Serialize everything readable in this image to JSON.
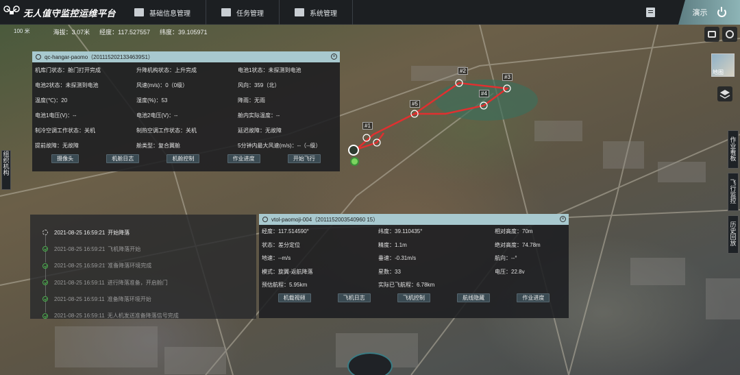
{
  "app": {
    "title": "无人值守监控运维平台"
  },
  "nav": [
    {
      "label": "基础信息管理",
      "icon": "database-icon"
    },
    {
      "label": "任务管理",
      "icon": "task-icon"
    },
    {
      "label": "系统管理",
      "icon": "settings-icon"
    }
  ],
  "header": {
    "demo_label": "演示"
  },
  "status": {
    "scale": "100 米",
    "altitude": "海拔：3.07米",
    "longitude": "经度：117.527557",
    "latitude": "纬度：39.105971"
  },
  "right_tools": {
    "basemap_label": "地图"
  },
  "side_tabs": {
    "work_board": "作业看板",
    "flight_monitor": "飞行监控",
    "history_replay": "历史回放",
    "org": "组织机构"
  },
  "hangar": {
    "title": "qc-hangar-paomo（2011152021334639S1）",
    "fields": [
      "机库门状态：舱门打开完成",
      "升降机构状态：上升完成",
      "电池1状态：未探测到电池",
      "电池2状态：未探测到电池",
      "风速(m/s)：0（0级）",
      "风向：359（北）",
      "温度(℃)：20",
      "湿度(%)：53",
      "降雨：无雨",
      "电池1电压(V)：--",
      "电池2电压(V)：--",
      "舱内实际温度：--",
      "制冷空调工作状态：关机",
      "制热空调工作状态：关机",
      "延迟故障：无故障",
      "提前故障：无故障",
      "舱类型：复合翼舱",
      "5分钟内最大风速(m/s)：--（--级）"
    ],
    "buttons": [
      "摄像头",
      "机舱日志",
      "机舱控制",
      "作业进度",
      "开始飞行"
    ]
  },
  "vtol": {
    "title": "vtol-paomoji-004（2011152003540960 15）",
    "fields": [
      "经度：117.514590°",
      "纬度：39.110435°",
      "相对高度：70m",
      "状态：差分定位",
      "精度：1.1m",
      "绝对高度：74.78m",
      "地速：--m/s",
      "垂速：-0.31m/s",
      "航向：--°",
      "模式：旋翼-返航降落",
      "星数：33",
      "电压：22.8v",
      "预估航程：5.95km",
      "实际已飞航程：6.78km",
      ""
    ],
    "buttons": [
      "机载视频",
      "飞机日志",
      "飞机控制",
      "航线隐藏",
      "作业进度"
    ]
  },
  "log": [
    {
      "time": "2021-08-25 16:59:21",
      "text": "开始降落"
    },
    {
      "time": "2021-08-25 16:59:21",
      "text": "飞机降落开始"
    },
    {
      "time": "2021-08-25 16:59:21",
      "text": "准备降落环境完成"
    },
    {
      "time": "2021-08-25 16:59:11",
      "text": "进行降落准备，开启舱门"
    },
    {
      "time": "2021-08-25 16:59:11",
      "text": "准备降落环境开始"
    },
    {
      "time": "2021-08-25 16:59:11",
      "text": "无人机发送准备降落信号完成"
    }
  ],
  "waypoints": [
    "#1",
    "#2",
    "#3",
    "#4",
    "#5"
  ],
  "colors": {
    "accent": "#a8c9cf",
    "route": "#e03030",
    "topbar": "#1c1f22"
  }
}
